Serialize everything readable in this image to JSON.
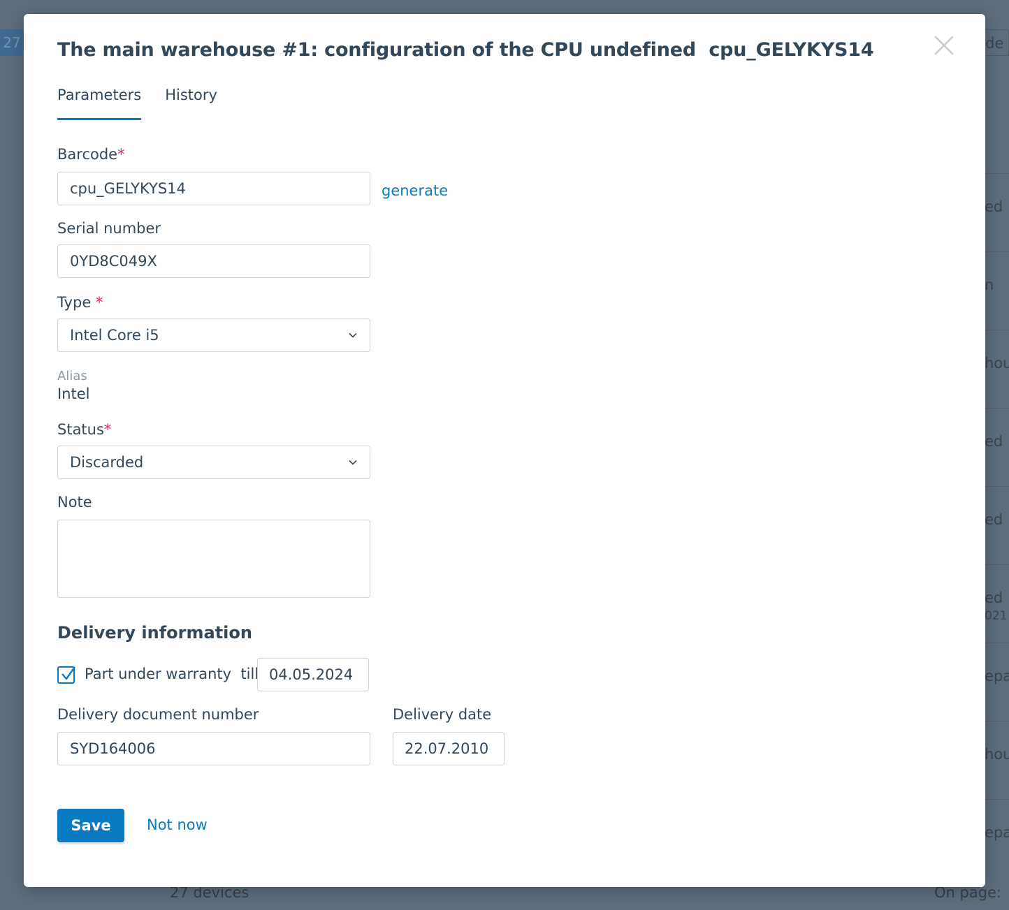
{
  "background": {
    "badge": "27",
    "top_right_text": "arde",
    "right_column": [
      "ed",
      "n",
      "hou",
      "ed",
      "ed",
      "ed",
      "021",
      "epa",
      "hou",
      "epa"
    ],
    "footer_left": "27 devices",
    "footer_right": "On page:"
  },
  "modal": {
    "title": "The main warehouse #1: configuration of the CPU undefined  cpu_GELYKYS14",
    "close_icon": "close-icon",
    "tabs": [
      {
        "label": "Parameters",
        "active": true
      },
      {
        "label": "History",
        "active": false
      }
    ],
    "form": {
      "barcode": {
        "label": "Barcode",
        "required_mark": "*",
        "value": "cpu_GELYKYS14",
        "generate_label": "generate"
      },
      "serial": {
        "label": "Serial number",
        "value": "0YD8C049X"
      },
      "type": {
        "label": "Type ",
        "required_mark": "*",
        "value": "Intel Core i5"
      },
      "alias": {
        "label": "Alias",
        "value": "Intel"
      },
      "status": {
        "label": "Status",
        "required_mark": "*",
        "value": "Discarded"
      },
      "note": {
        "label": "Note",
        "value": ""
      }
    },
    "delivery": {
      "title": "Delivery information",
      "warranty_checked": true,
      "warranty_label": "Part under warranty  till",
      "warranty_date": "04.05.2024",
      "doc_number_label": "Delivery document number",
      "doc_number": "SYD164006",
      "date_label": "Delivery date",
      "date": "22.07.2010"
    },
    "actions": {
      "save": "Save",
      "cancel": "Not now"
    }
  },
  "colors": {
    "accent": "#0a7bc2",
    "required": "#e0266f",
    "text": "#33475b",
    "overlay": "#5d6d7c"
  }
}
